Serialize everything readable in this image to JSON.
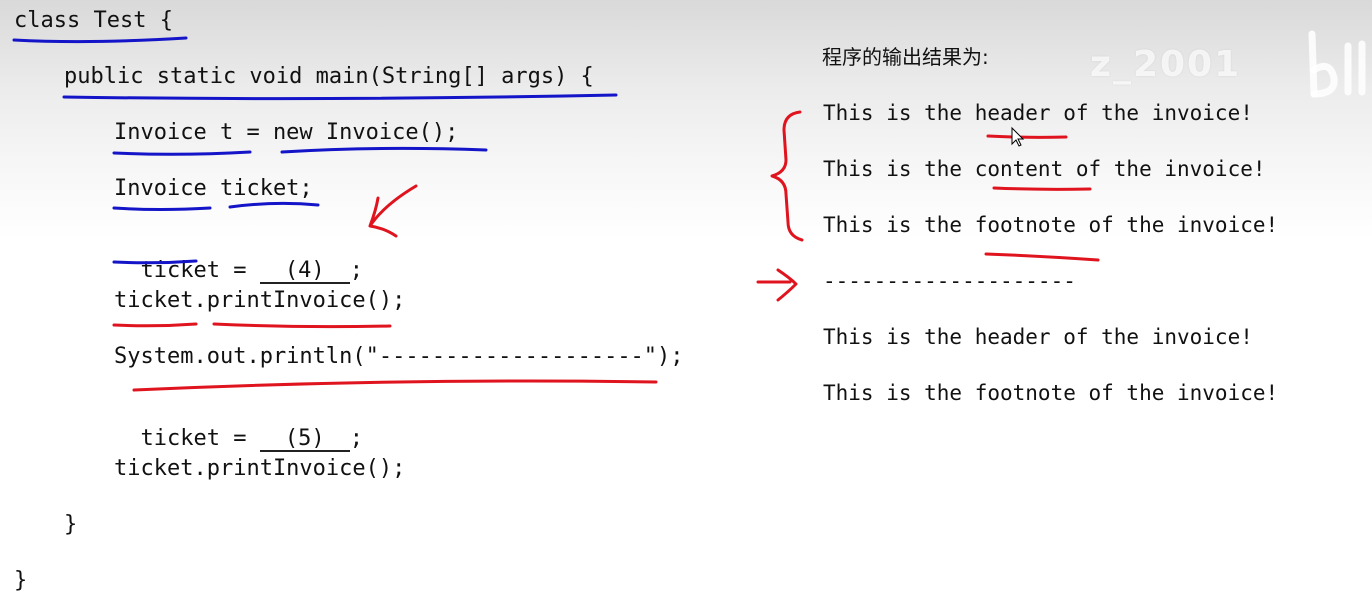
{
  "code": {
    "lines": [
      "class Test {",
      "public static void main(String[] args) {",
      "Invoice t = new Invoice();",
      "Invoice ticket;",
      "ticket = ",
      "ticket.printInvoice();",
      "System.out.println(\"--------------------\");",
      "ticket = ",
      "ticket.printInvoice();",
      "}",
      "}"
    ],
    "blank_4": "(4)",
    "blank_5": "(5)",
    "semicolon": ";"
  },
  "output": {
    "title": "程序的输出结果为:",
    "lines": [
      "This is the header of the invoice!",
      "This is the content of the invoice!",
      "This is the footnote of the invoice!",
      "--------------------",
      "This is the header of the invoice!",
      "This is the footnote of the invoice!"
    ]
  },
  "watermark": "z_2001",
  "colors": {
    "blue_ink": "#1414c8",
    "red_ink": "#e0141e"
  }
}
